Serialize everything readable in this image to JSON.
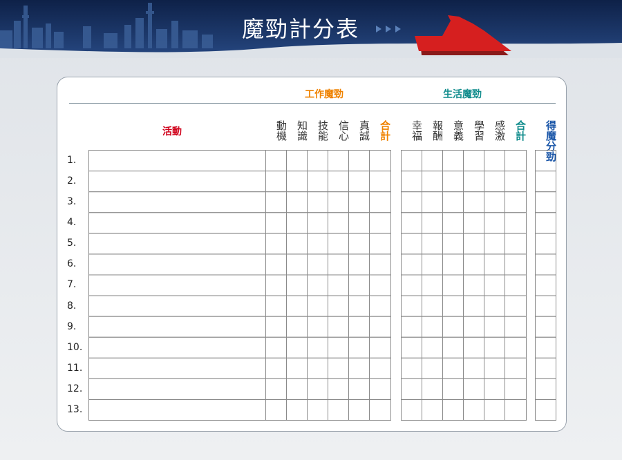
{
  "title": "魔勁計分表",
  "groups": {
    "work": "工作魔勁",
    "life": "生活魔勁"
  },
  "activity_header": "活動",
  "work_columns": [
    "動機",
    "知識",
    "技能",
    "信心",
    "真誠",
    "合計"
  ],
  "life_columns": [
    "幸福",
    "報酬",
    "意義",
    "學習",
    "感激",
    "合計"
  ],
  "score_column": "得魔分勁",
  "row_numbers": [
    "1.",
    "2.",
    "3.",
    "4.",
    "5.",
    "6.",
    "7.",
    "8.",
    "9.",
    "10.",
    "11.",
    "12.",
    "13."
  ],
  "colors": {
    "banner": "#17305f",
    "arrow": "#d61f1f",
    "work": "#ef8200",
    "life": "#108c8c",
    "score": "#1a56a8",
    "activity": "#d0021b"
  }
}
